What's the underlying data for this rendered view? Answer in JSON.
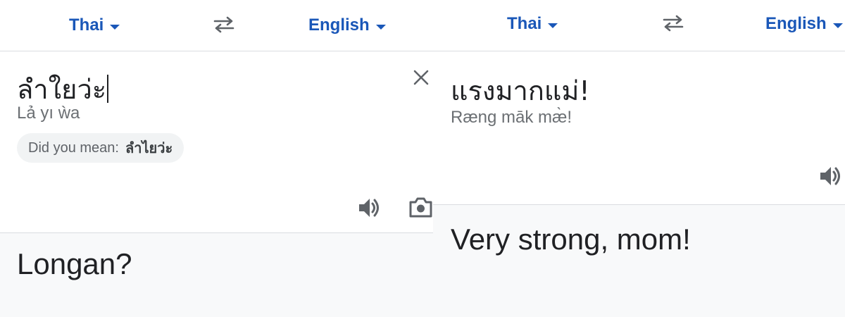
{
  "left": {
    "source_lang": "Thai",
    "target_lang": "English",
    "input_text": "ลำใยว่ะ",
    "transliteration": "Lả yı ẁa",
    "did_you_mean_label": "Did you mean:",
    "did_you_mean_value": "ลำไยว่ะ",
    "translation": "Longan?"
  },
  "right": {
    "source_lang": "Thai",
    "target_lang": "English",
    "source_text": "แรงมากแม่!",
    "transliteration": "Ræng māk mæ̀!",
    "translation": "Very strong, mom!"
  },
  "icons": {
    "swap": "swap-arrows-icon",
    "clear": "close-icon",
    "speaker": "speaker-icon",
    "camera": "camera-icon"
  },
  "colors": {
    "accent": "#1a57b8",
    "translation_bg": "#f8f9fa",
    "chip_bg": "#f1f3f4",
    "icon_gray": "#5f6368"
  }
}
